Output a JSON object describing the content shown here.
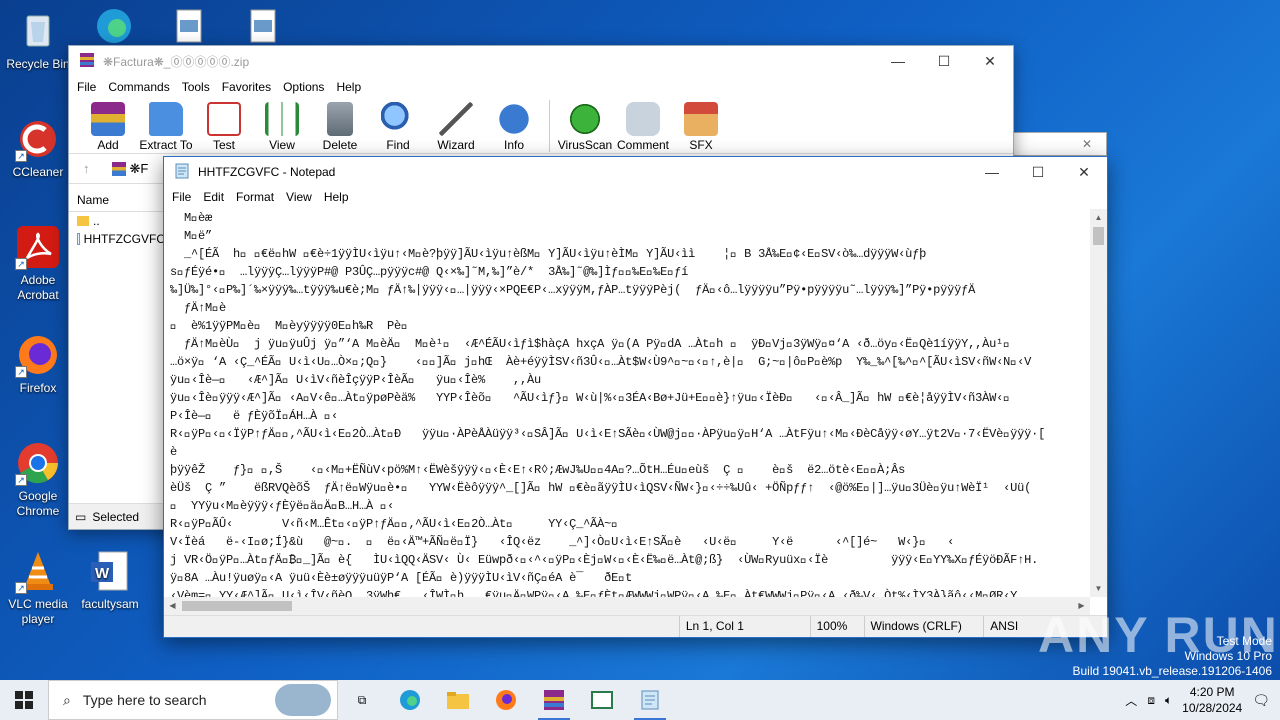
{
  "desktop": {
    "icons": [
      {
        "label": "Recycle Bin"
      },
      {
        "label": "CCleaner"
      },
      {
        "label": "Adobe Acrobat"
      },
      {
        "label": "Firefox"
      },
      {
        "label": "Google Chrome"
      },
      {
        "label": "VLC media player"
      },
      {
        "label": "facultysam"
      }
    ]
  },
  "winrar": {
    "title": "❋Factura❋_⓪⓪⓪⓪⓪.zip",
    "menu": [
      "File",
      "Commands",
      "Tools",
      "Favorites",
      "Options",
      "Help"
    ],
    "toolbar": [
      "Add",
      "Extract To",
      "Test",
      "View",
      "Delete",
      "Find",
      "Wizard",
      "Info",
      "VirusScan",
      "Comment",
      "SFX"
    ],
    "address": "❋F",
    "list_header": "Name",
    "rows": [
      "..",
      "HHTFZCGVFC"
    ],
    "status": "Selected"
  },
  "notepad": {
    "title": "HHTFZCGVFC - Notepad",
    "menu": [
      "File",
      "Edit",
      "Format",
      "View",
      "Help"
    ],
    "content": "  M￿èæ\n  M￿ë”\n  _^[ÉÃ  h￿ ￿€ë￿hW ￿€è÷1ÿÿÌU‹ìÿu↑‹M￿è?þÿÿ]ÃU‹ìÿu↑èßM￿ Y]ÃU‹ìÿu↑èÌM￿ Y]ÃU‹ìì    ¦￿ B 3Å‰E￿¢‹E￿SV‹ò‰…dÿÿÿW‹ùƒþ\ns￿ƒÉÿé•￿  …lÿÿÿÇ…lÿÿÿP#@ P3ÛÇ…pÿÿÿc#@ Q‹×‰]˜M,‰]”è/*  3Å‰]˜@‰]Ìƒ￿￿‰E￿‰E￿ƒí\n‰]Ü‰]°‹￿P‰]´‰×ÿÿÿ‰…tÿÿÿ‰u€è;M￿ ƒÄ↑‰|ÿÿÿ‹￿…|ÿÿÿ‹×PQE€P‹…xÿÿÿM,ƒÀP…tÿÿÿPèj(  ƒÄ￿‹ô…lÿÿÿÿu”Pÿ•pÿÿÿÿu˜…lÿÿÿ‰]”Pÿ•pÿÿÿƒÄ\n  ƒÄ↑M￿è\n￿  è%1ÿÿPM￿è￿  M￿èyÿÿÿÿ0E￿h‰R  Pè￿\n  ƒÄ↑M￿èÙ￿  j ÿu￿ÿuÛj ÿ￿”‘A M￿èÄ￿  M￿è¹￿  ‹Æ^ÉÃU‹ìƒì$hàçA hxçA ÿ￿(A Pÿ￿dA …Àt￿h ￿  ÿÐ￿Vj￿3ÿWÿ￿¤‘A ‹ð…öy￿‹Ë￿Qè1íÿÿY,,Àu¹￿\n…ö×ÿ￿ ‘A ‹Ç_^ÉÃ￿ U‹ì‹U￿…Ò×￿;Q￿}    ‹￿￿]Ã￿ j￿hŒ  Àè+éÿÿÌSV‹ñ3Û‹￿…Àt$W‹Ù9^￿~￿‹￿↑,è|￿  G;~￿|ô￿P￿è%p  Y‰_‰^[‰^￿^[ÃU‹ìSV‹ñW‹N￿‹V\nÿu￿‹Îè—￿   ‹Æ^]Ã￿ U‹ìV‹ñèÎçÿÿP‹ÎèÃ￿   ÿu￿‹Îè%    ,,Àu\nÿu￿‹Îè￿ÿÿÿ‹Æ^]Ã￿ ‹A￿V‹ê￿…Àt￿ÿpøPèä%   YYP‹Îèõ￿   ^ÃU‹ìƒ}￿ W‹ù|%‹￿3ÉA‹Bø+Jü+E￿￿è}↑ÿu￿‹ÏèÐ￿   ‹￿‹Â_]Ã￿ hW ￿€è¦åÿÿÌV‹ñ3ÀW‹￿\nP‹Îè—￿   ë ƒÈÿõÏ￿ÁH…À ￿‹\nR‹￿ÿP￿‹￿‹ÏÿP↑ƒÄ￿￿‚^ÃU‹ì‹E￿2Ò…Àt￿Ð   ÿÿu￿·ÀPèÅÀüÿÿ³‹￿SÂ]Ã￿ U‹ì‹E↑SÃè￿‹ÙW@j￿￿·ÀPÿu￿ÿ￿H‘A …ÀtFÿu↑‹M￿‹ÐèCåÿÿ‹øY…ÿt2V￿·7‹ËVè￿ÿÿÿ·[\nè\nþÿÿêŽ    ƒ}￿ ￿,Š    ‹￿‹M￿+ËÑùV‹pö%M↑‹ËWèšÿÿÿ‹￿‹È‹E↑‹R◊;ÆwJ‰U￿￿4A￿?…ÕtH…Éu￿eùš  Ç ￿    è￿š  ë2…ötè‹E￿￿À;Âs\nèÜš  Ç ”    ëßRVQèõŠ  ƒÄ↑ë￿Wÿu￿è•￿   YYW‹Ëèôÿÿÿ^_[]Ã￿ hW ￿€è￿ãÿÿÌU‹ìQSV‹ÑW‹}￿‹÷÷‰Uû‹ +ÖÑpƒƒ↑  ‹@ö%E￿|]…ÿu￿3Üè￿ÿu↑WèÏ¹  ‹Uü(\n￿  YYÿu‹M￿èÿÿÿ‹ƒÈÿë￿ä￿Ä￿B…H…À ￿‹\nR‹￿ÿP￿ÃÛ‹\tV‹ñ‹M…Êt￿‹￿ÿP↑ƒÄ￿￿‚^ÃU‹ì‹E￿2Ò…Àt￿     YY‹Ç_^ÃÀ~￿\nV‹Ïèá   ë-‹I￿ø;Í}&ù   @~￿.  ￿  ë￿‹Ä™+ÃÑ￿ë￿Ï}   ‹ÎQ‹ëz    _^]‹Ò￿U‹ì‹E↑SÃ￿è   ‹U‹ë￿     Y‹ë      ‹^[]é~   W‹}￿   ‹︎\nj VR‹Ö￿ÿP￿…Àt￿ƒÄ￿₿￿_]Ã￿ è{   ÌU‹ìQQ‹ÄSV‹ Ù‹ Eüwpð‹￿‹^‹￿ÿP￿‹Èj￿W‹￿‹È‹Ë‰￿ë…Àt@;ß}  ‹ÙW￿Ryuüx￿‹Ïè         ÿÿÿ‹E￿YY‰X￿ƒÉÿöÐÃF↑H.\nÿ￿8A …Àu!ÿuøÿ￿‹A ÿuü‹Èè±øÿÿÿuüÿP‘A [ÉÃ￿ è)ÿÿÿÌU‹ìV‹ñÇ￿éA è¯   ðE￿t\n‹Vèm=￿ YY‹Æ^]Ã￿ U‹ì‹ÎV‹ñèQ  3ÿWh€   ‹ÎWÌ￿h   €ÿu￿Ä￿WPÿ￿‹A ‰E￿ƒÈt￿ÆWWWj￿WPÿ￿‹A ‰E￿ Àt€WWWj￿Pÿ￿‹A ‹ð‰V‹ Òt%‹ÌY3À}ãô‹‹M￿ØR‹Y",
    "status": {
      "pos": "Ln 1, Col 1",
      "zoom": "100%",
      "eol": "Windows (CRLF)",
      "enc": "ANSI"
    }
  },
  "watermark": {
    "line1": "Test Mode",
    "line2": "Windows 10 Pro",
    "line3": "Build 19041.vb_release.191206-1406",
    "brand": "ANY RUN"
  },
  "taskbar": {
    "search_placeholder": "Type here to search",
    "time": "4:20 PM",
    "date": "10/28/2024"
  }
}
